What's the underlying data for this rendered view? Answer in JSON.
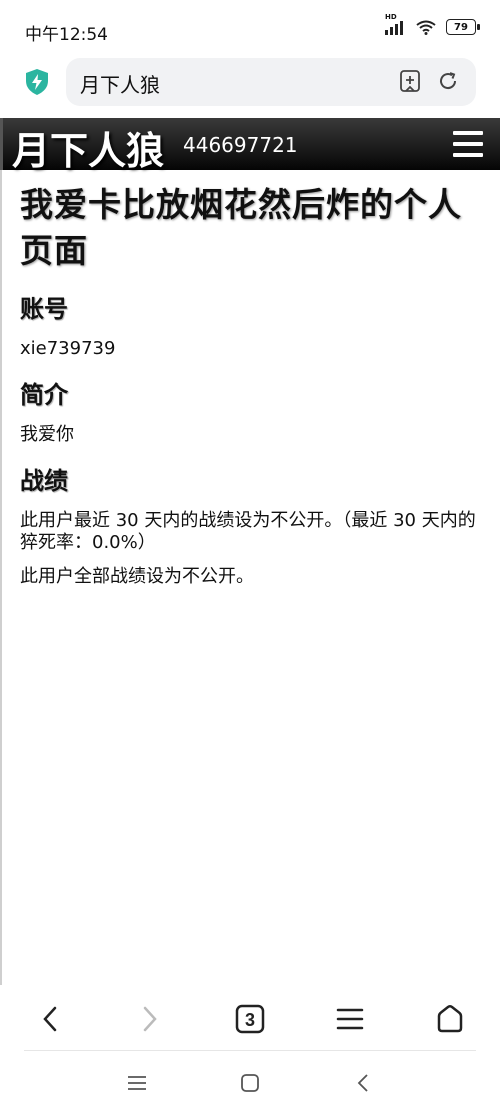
{
  "status_bar": {
    "time": "中午12:54",
    "battery": "79",
    "signal_label": "HD"
  },
  "browser": {
    "url_text": "月下人狼",
    "tab_count": "3"
  },
  "site": {
    "logo": "月下人狼",
    "id": "446697721"
  },
  "profile": {
    "title": "我爱卡比放烟花然后炸的个人页面",
    "sections": [
      {
        "heading": "账号",
        "lines": [
          "xie739739"
        ]
      },
      {
        "heading": "简介",
        "lines": [
          "我爱你"
        ]
      },
      {
        "heading": "战绩",
        "lines": [
          "此用户最近 30 天内的战绩设为不公开。（最近 30 天内的猝死率：0.0%）",
          "此用户全部战绩设为不公开。"
        ]
      }
    ]
  },
  "icons": {
    "shield": "shield-bolt-icon",
    "bookmark": "add-bookmark-icon",
    "refresh": "refresh-icon",
    "menu": "hamburger-menu-icon",
    "back": "back-arrow-icon",
    "forward": "forward-arrow-icon",
    "tabs": "tabs-icon",
    "browser_menu": "menu-icon",
    "home": "home-icon"
  },
  "colors": {
    "accent": "#2bb5a0",
    "header_bg": "#111111"
  }
}
